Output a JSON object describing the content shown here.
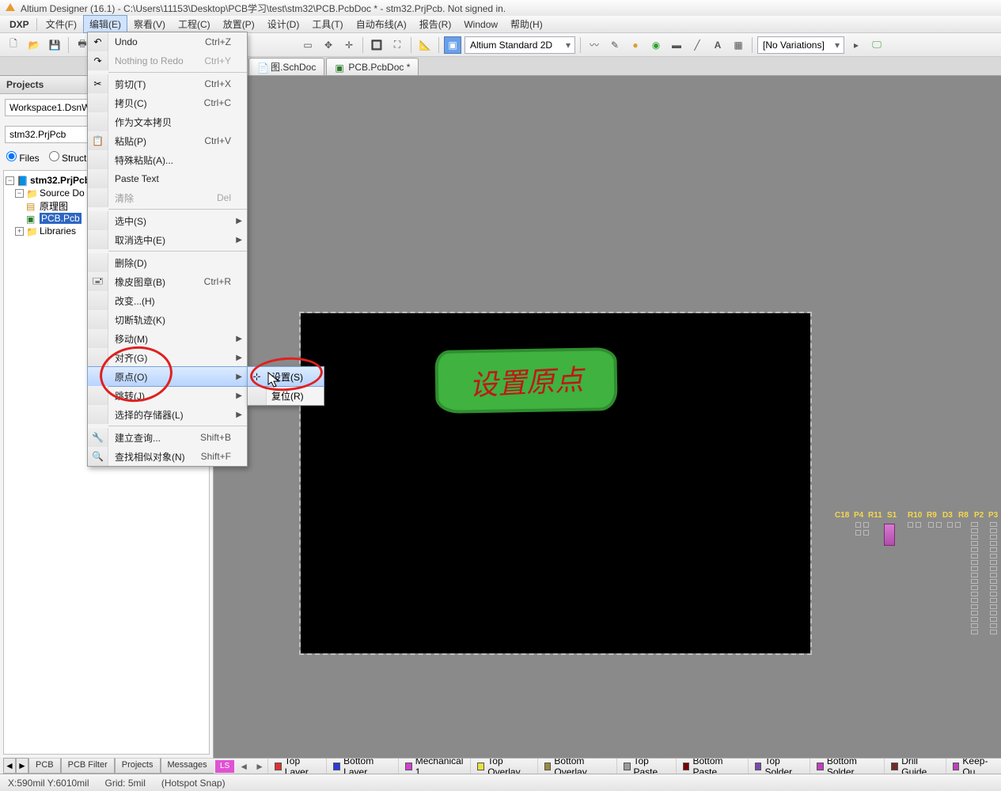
{
  "title": "Altium Designer (16.1) - C:\\Users\\11153\\Desktop\\PCB学习\\test\\stm32\\PCB.PcbDoc * - stm32.PrjPcb. Not signed in.",
  "menubar": {
    "dxp": "DXP",
    "items": [
      "文件(F)",
      "编辑(E)",
      "察看(V)",
      "工程(C)",
      "放置(P)",
      "设计(D)",
      "工具(T)",
      "自动布线(A)",
      "报告(R)",
      "Window",
      "帮助(H)"
    ]
  },
  "toolbar": {
    "view_mode": "Altium Standard 2D",
    "variations": "[No Variations]"
  },
  "doc_tabs": [
    {
      "label": "图.SchDoc"
    },
    {
      "label": "PCB.PcbDoc *"
    }
  ],
  "projects": {
    "title": "Projects",
    "workspace": "Workspace1.DsnW",
    "project": "stm32.PrjPcb",
    "radio_files": "Files",
    "radio_struct": "Struct",
    "tree": {
      "root": "stm32.PrjPcb",
      "src": "Source Do",
      "sch": "原理图",
      "pcb": "PCB.Pcb",
      "libs": "Libraries"
    }
  },
  "edit_menu": [
    {
      "label": "Undo",
      "sc": "Ctrl+Z",
      "icon": "undo-icon"
    },
    {
      "label": "Nothing to Redo",
      "sc": "Ctrl+Y",
      "dis": true,
      "icon": "redo-icon"
    },
    {
      "sep": true
    },
    {
      "label": "剪切(T)",
      "sc": "Ctrl+X",
      "icon": "cut-icon"
    },
    {
      "label": "拷贝(C)",
      "sc": "Ctrl+C"
    },
    {
      "label": "作为文本拷贝"
    },
    {
      "label": "粘贴(P)",
      "sc": "Ctrl+V",
      "icon": "paste-icon"
    },
    {
      "label": "特殊粘贴(A)..."
    },
    {
      "label": "Paste Text"
    },
    {
      "label": "清除",
      "sc": "Del",
      "dis": true
    },
    {
      "sep": true
    },
    {
      "label": "选中(S)",
      "sub": true
    },
    {
      "label": "取消选中(E)",
      "sub": true
    },
    {
      "sep": true
    },
    {
      "label": "删除(D)"
    },
    {
      "label": "橡皮图章(B)",
      "sc": "Ctrl+R",
      "icon": "stamp-icon"
    },
    {
      "label": "改变...(H)"
    },
    {
      "label": "切断轨迹(K)"
    },
    {
      "label": "移动(M)",
      "sub": true
    },
    {
      "label": "对齐(G)",
      "sub": true
    },
    {
      "label": "原点(O)",
      "sub": true,
      "hl": true
    },
    {
      "label": "跳转(J)",
      "sub": true
    },
    {
      "label": "选择的存储器(L)",
      "sub": true
    },
    {
      "sep": true
    },
    {
      "label": "建立查询...",
      "sc": "Shift+B",
      "icon": "query-icon"
    },
    {
      "label": "查找相似对象(N)",
      "sc": "Shift+F",
      "icon": "find-icon"
    }
  ],
  "sub_menu": [
    {
      "label": "设置(S)",
      "hl": true,
      "icon": "origin-set-icon"
    },
    {
      "label": "复位(R)"
    }
  ],
  "annotation_text": "设置原点",
  "components": [
    "C18",
    "P4",
    "R11",
    "S1",
    "R10",
    "R9",
    "D3",
    "R8",
    "P2",
    "P3"
  ],
  "panel_tabs": [
    "PCB",
    "PCB Filter",
    "Projects",
    "Messages",
    "PCB"
  ],
  "layer_bar": {
    "ls": "LS",
    "layers": [
      {
        "name": "Top Layer",
        "color": "#e03030"
      },
      {
        "name": "Bottom Layer",
        "color": "#2b3bda"
      },
      {
        "name": "Mechanical 1",
        "color": "#d040d0"
      },
      {
        "name": "Top Overlay",
        "color": "#e8e040"
      },
      {
        "name": "Bottom Overlay",
        "color": "#9a8a3a"
      },
      {
        "name": "Top Paste",
        "color": "#9a9a9a"
      },
      {
        "name": "Bottom Paste",
        "color": "#7a0000"
      },
      {
        "name": "Top Solder",
        "color": "#7a4aaa"
      },
      {
        "name": "Bottom Solder",
        "color": "#c040c0"
      },
      {
        "name": "Drill Guide",
        "color": "#702828"
      },
      {
        "name": "Keep-Ou",
        "color": "#c040c0"
      }
    ]
  },
  "status": {
    "coords": "X:590mil Y:6010mil",
    "grid": "Grid: 5mil",
    "snap": "(Hotspot Snap)"
  }
}
